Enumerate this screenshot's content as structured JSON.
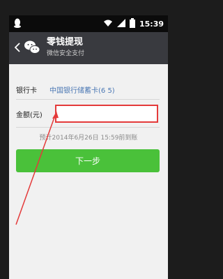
{
  "status_bar": {
    "time": "15:39",
    "icons": [
      "qq-icon",
      "wifi-icon",
      "signal-icon",
      "battery-icon"
    ]
  },
  "app_bar": {
    "title": "零钱提现",
    "subtitle": "微信安全支付",
    "back_icon": "chevron-left-icon",
    "app_icon": "wechat-icon"
  },
  "form": {
    "bank_label": "银行卡",
    "bank_value": "中国银行储蓄卡(6  5)",
    "amount_label": "金额(元)",
    "amount_value": "",
    "eta_text": "预计2014年6月26日 15:59前到账"
  },
  "next_button": {
    "label": "下一步"
  },
  "colors": {
    "status_bg": "#0b0b0b",
    "app_bar_bg": "#393a3f",
    "page_bg": "#f1f1f1",
    "accent_green": "#4ac13a",
    "highlight_red": "#e43a3a",
    "link_blue": "#4b78b4"
  }
}
